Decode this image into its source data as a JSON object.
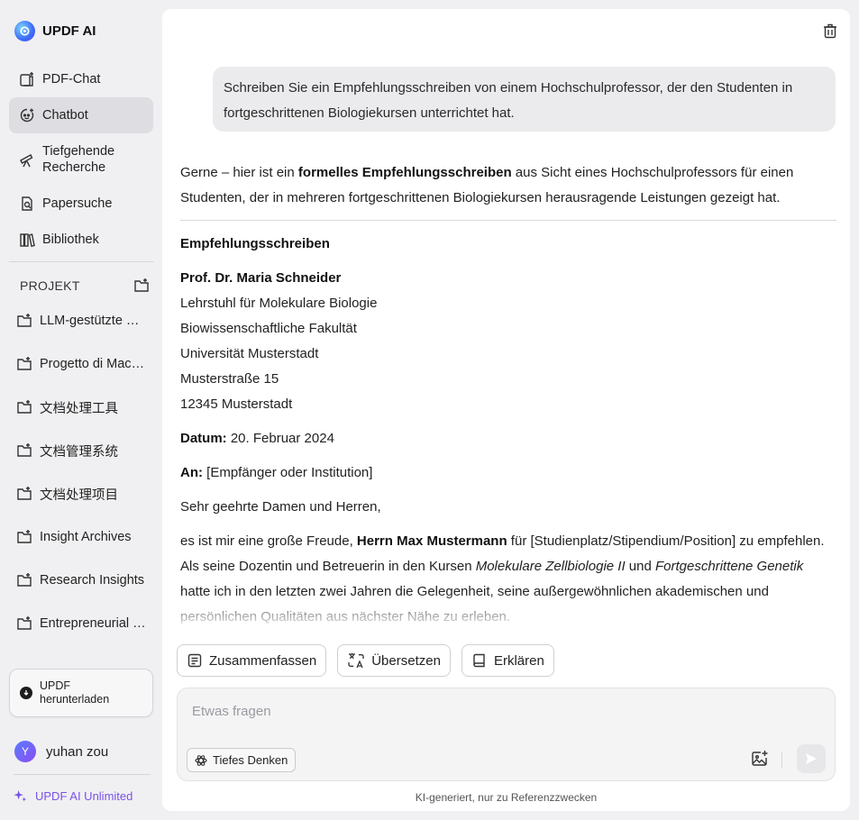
{
  "sidebar": {
    "brand": "UPDF AI",
    "nav": [
      {
        "label": "PDF-Chat",
        "icon": "pdf-chat-icon"
      },
      {
        "label": "Chatbot",
        "icon": "chatbot-icon",
        "active": true
      },
      {
        "label": "Tiefgehende",
        "label2": "Recherche",
        "icon": "telescope-icon"
      },
      {
        "label": "Papersuche",
        "icon": "paper-search-icon"
      },
      {
        "label": "Bibliothek",
        "icon": "library-icon"
      }
    ],
    "project_header": "PROJEKT",
    "projects": [
      "LLM-gestützte Systeme",
      "Progetto di Machine Learning",
      "文档处理工具",
      "文档管理系统",
      "文档处理项目",
      "Insight Archives",
      "Research Insights",
      "Entrepreneurial Projects"
    ],
    "download": {
      "line1": "UPDF",
      "line2": "herunterladen"
    },
    "user": {
      "initial": "Y",
      "name": "yuhan zou"
    },
    "unlimited": "UPDF AI Unlimited"
  },
  "chat": {
    "user_message": "Schreiben Sie ein Empfehlungsschreiben von einem Hochschulprofessor, der den Studenten in fortgeschrittenen Biologiekursen unterrichtet hat.",
    "answer": {
      "intro_before": "Gerne – hier ist ein ",
      "intro_bold": "formelles Empfehlungsschreiben",
      "intro_after": " aus Sicht eines Hochschulprofessors für einen Studenten, der in mehreren fortgeschrittenen Biologiekursen herausragende Leistungen gezeigt hat.",
      "heading": "Empfehlungsschreiben",
      "sender_name": "Prof. Dr. Maria Schneider",
      "sender_lines": [
        "Lehrstuhl für Molekulare Biologie",
        "Biowissenschaftliche Fakultät",
        "Universität Musterstadt",
        "Musterstraße 15",
        "12345 Musterstadt"
      ],
      "date_label": "Datum:",
      "date_value": " 20. Februar 2024",
      "to_label": "An:",
      "to_value": " [Empfänger oder Institution]",
      "salutation": "Sehr geehrte Damen und Herren,",
      "body_1": "es ist mir eine große Freude, ",
      "body_bold": "Herrn Max Mustermann",
      "body_2": " für [Studienplatz/Stipendium/Position] zu empfehlen. Als seine Dozentin und Betreuerin in den Kursen ",
      "course_1": "Molekulare Zellbiologie II",
      "body_3": " und ",
      "course_2": "Fortgeschrittene Genetik",
      "body_4": " hatte ich in den letzten zwei Jahren die Gelegenheit, seine außergewöhnlichen akademischen und persönlichen Qualitäten aus nächster Nähe zu erleben."
    },
    "actions": [
      "Zusammenfassen",
      "Übersetzen",
      "Erklären"
    ],
    "input_placeholder": "Etwas fragen",
    "deep_think": "Tiefes Denken",
    "disclaimer": "KI-generiert, nur zu Referenzzwecken"
  },
  "colors": {
    "accent": "#7a52e8",
    "active_bg": "#dedee2",
    "page_bg": "#f0f0f2"
  }
}
